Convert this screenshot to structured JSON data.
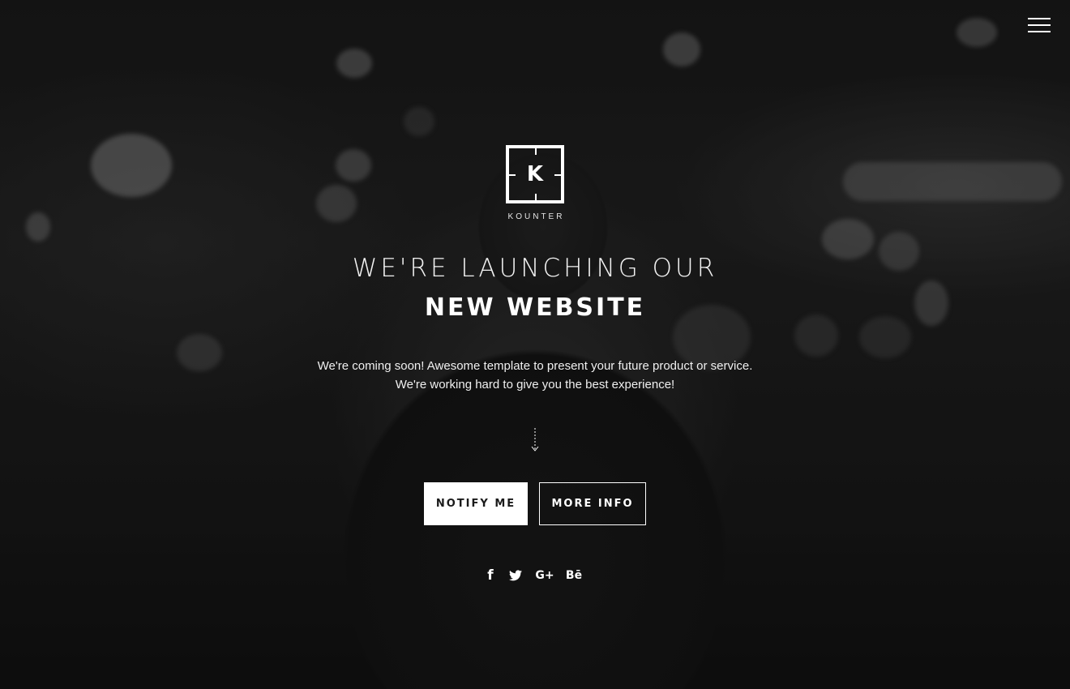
{
  "brand": {
    "logo_letter": "K",
    "name": "KOUNTER"
  },
  "headline": {
    "line1": "WE'RE LAUNCHING OUR",
    "line2": "NEW WEBSITE"
  },
  "description": {
    "line1": "We're coming soon! Awesome template to present your future product or service.",
    "line2": "We're working hard to give you the best experience!"
  },
  "buttons": {
    "notify_label": "NOTIFY ME",
    "more_info_label": "MORE INFO"
  },
  "social": [
    {
      "icon": "facebook-icon",
      "glyph": "f"
    },
    {
      "icon": "twitter-icon",
      "glyph": ""
    },
    {
      "icon": "google-plus-icon",
      "glyph": "G+"
    },
    {
      "icon": "behance-icon",
      "glyph": "Bē"
    }
  ],
  "icons": {
    "menu": "hamburger-menu-icon",
    "scroll": "scroll-down-arrow-icon"
  },
  "colors": {
    "background": "#1b1b1b",
    "text": "#ffffff",
    "primary_button_bg": "#ffffff",
    "primary_button_text": "#1a1a1a"
  }
}
